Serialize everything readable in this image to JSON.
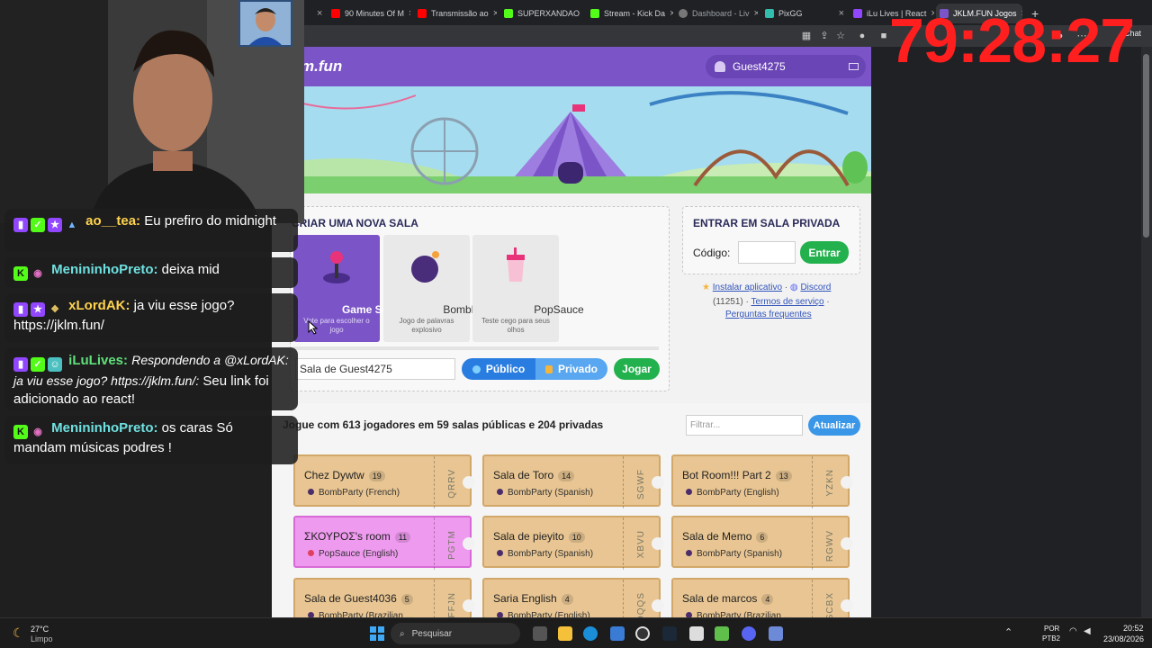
{
  "browser": {
    "tabs": [
      {
        "label": "90 Minutes Of M",
        "color": "#ff0000"
      },
      {
        "label": "Transmissão ao",
        "color": "#ff0000"
      },
      {
        "label": "SUPERXANDAO",
        "color": "#53fc18"
      },
      {
        "label": "Stream - Kick Da",
        "color": "#53fc18"
      },
      {
        "label": "Dashboard - Liv",
        "color": "#888888"
      },
      {
        "label": "PixGG",
        "color": "#32bcad"
      },
      {
        "label": "iLu Lives | React",
        "color": "#9146ff"
      },
      {
        "label": "JKLM.FUN Jogos",
        "color": "#7b55c7"
      }
    ],
    "chat_label": "Chat",
    "new_tab": "+"
  },
  "timer": "79:28:27",
  "site": {
    "logo": "m.fun",
    "username": "Guest4275"
  },
  "create_room": {
    "title": "CRIAR UMA NOVA SALA",
    "games": [
      {
        "name": "Game Selector",
        "desc": "Vote para escolher o jogo"
      },
      {
        "name": "BombParty",
        "desc": "Jogo de palavras explosivo"
      },
      {
        "name": "PopSauce",
        "desc": "Teste cego para seus olhos"
      }
    ],
    "room_name_value": "Sala de Guest4275",
    "public_label": "Público",
    "private_label": "Privado",
    "play_label": "Jogar"
  },
  "private_room": {
    "title": "ENTRAR EM SALA PRIVADA",
    "code_label": "Código:",
    "enter_label": "Entrar",
    "install_link": "Instalar aplicativo",
    "discord_link": "Discord",
    "count": "(11251)",
    "terms_link": "Termos de serviço",
    "faq_link": "Perguntas frequentes",
    "dot_sep": "·"
  },
  "rooms_header": {
    "text": "Jogue com 613 jogadores em 59 salas públicas e 204 privadas",
    "filter_placeholder": "Filtrar...",
    "refresh_label": "Atualizar"
  },
  "rooms": [
    {
      "name": "Chez Dywtw",
      "count": "19",
      "game": "BombParty (French)",
      "code": "QRRV",
      "bg": "#e8c592",
      "dot": "#4a2d6a"
    },
    {
      "name": "Sala de Toro",
      "count": "14",
      "game": "BombParty (Spanish)",
      "code": "SGWF",
      "bg": "#e8c592",
      "dot": "#4a2d6a"
    },
    {
      "name": "Bot Room!!! Part 2",
      "count": "13",
      "game": "BombParty (English)",
      "code": "YZKN",
      "bg": "#e8c592",
      "dot": "#4a2d6a"
    },
    {
      "name": "ΣΚΟΥΡΟΣ's room",
      "count": "11",
      "game": "PopSauce (English)",
      "code": "PGTM",
      "bg": "#ee9aee",
      "dot": "#e04060"
    },
    {
      "name": "Sala de pieyito",
      "count": "10",
      "game": "BombParty (Spanish)",
      "code": "XBVU",
      "bg": "#e8c592",
      "dot": "#4a2d6a"
    },
    {
      "name": "Sala de Memo",
      "count": "6",
      "game": "BombParty (Spanish)",
      "code": "RGWV",
      "bg": "#e8c592",
      "dot": "#4a2d6a"
    },
    {
      "name": "Sala de Guest4036",
      "count": "5",
      "game": "BombParty (Brazilian ...",
      "code": "FFJN",
      "bg": "#e8c592",
      "dot": "#4a2d6a"
    },
    {
      "name": "Saria English",
      "count": "4",
      "game": "BombParty (English)",
      "code": "DQQS",
      "bg": "#e8c592",
      "dot": "#4a2d6a"
    },
    {
      "name": "Sala de marcos",
      "count": "4",
      "game": "BombParty (Brazilian ...",
      "code": "SCBX",
      "bg": "#e8c592",
      "dot": "#4a2d6a"
    }
  ],
  "chat": [
    {
      "user": "ao__tea:",
      "msg": "Eu prefiro do midnight",
      "ucolor": "#ffd34f"
    },
    {
      "user": "MenininhoPreto:",
      "msg": "deixa mid",
      "ucolor": "#6fe0e0"
    },
    {
      "user": "xLordAK:",
      "msg": "ja viu esse jogo? https://jklm.fun/",
      "ucolor": "#ffd34f"
    },
    {
      "user": "iLuLives:",
      "msg_italic": "Respondendo a @xLordAK: ja viu esse jogo? https://jklm.fun/:",
      "msg": "Seu link foi adicionado ao react!",
      "ucolor": "#5fe07a"
    },
    {
      "user": "MenininhoPreto:",
      "msg": "os caras Só mandam músicas podres !",
      "ucolor": "#6fe0e0"
    }
  ],
  "taskbar": {
    "weather_temp": "27°C",
    "weather_desc": "Limpo",
    "search_placeholder": "Pesquisar",
    "lang1": "POR",
    "lang2": "PTB2",
    "time": "20:52",
    "date": "23/08/2026"
  }
}
